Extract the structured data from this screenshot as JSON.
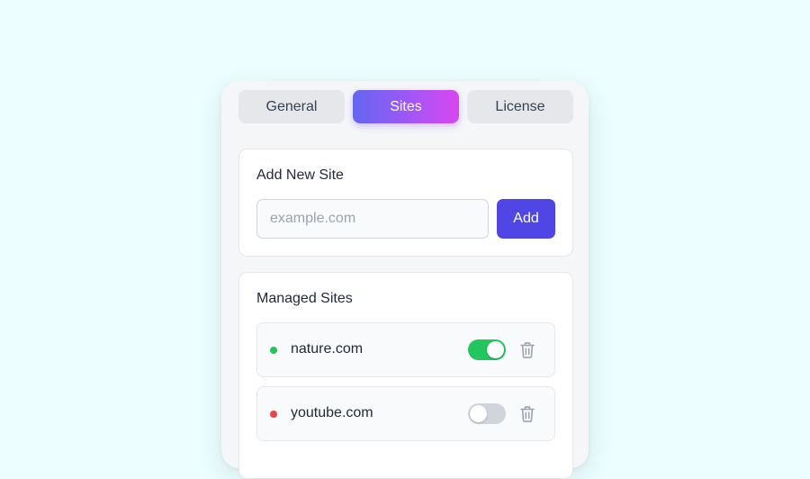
{
  "tabs": [
    {
      "label": "General",
      "active": false
    },
    {
      "label": "Sites",
      "active": true
    },
    {
      "label": "License",
      "active": false
    }
  ],
  "add_site": {
    "title": "Add New Site",
    "input_placeholder": "example.com",
    "input_value": "",
    "button_label": "Add"
  },
  "managed": {
    "title": "Managed Sites",
    "sites": [
      {
        "domain": "nature.com",
        "enabled": true,
        "status_color": "#22c55e",
        "icon": "trash-icon"
      },
      {
        "domain": "youtube.com",
        "enabled": false,
        "status_color": "#ef4444",
        "icon": "trash-icon"
      }
    ]
  },
  "colors": {
    "background": "#ecfeff",
    "accent": "#4f46e5",
    "tab_gradient_start": "#6366f1",
    "tab_gradient_end": "#d946ef",
    "toggle_on": "#22c55e",
    "toggle_off": "#d1d5db"
  }
}
